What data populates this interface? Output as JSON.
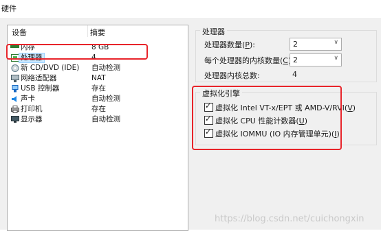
{
  "window": {
    "title": "硬件"
  },
  "devices": {
    "header": {
      "col_device": "设备",
      "col_summary": "摘要"
    },
    "items": [
      {
        "icon": "memory-icon",
        "name": "内存",
        "summary": "8 GB"
      },
      {
        "icon": "processor-icon",
        "name": "处理器",
        "summary": "4"
      },
      {
        "icon": "cd-dvd-icon",
        "name": "新 CD/DVD (IDE)",
        "summary": "自动检测"
      },
      {
        "icon": "network-adapter-icon",
        "name": "网络适配器",
        "summary": "NAT"
      },
      {
        "icon": "usb-icon",
        "name": "USB 控制器",
        "summary": "存在"
      },
      {
        "icon": "sound-card-icon",
        "name": "声卡",
        "summary": "自动检测"
      },
      {
        "icon": "printer-icon",
        "name": "打印机",
        "summary": "存在"
      },
      {
        "icon": "display-icon",
        "name": "显示器",
        "summary": "自动检测"
      }
    ],
    "selected": "处理器"
  },
  "processor_group": {
    "legend": "处理器",
    "num_processors": {
      "label_pre": "处理器数量(",
      "key": "P",
      "label_post": "):",
      "value": "2"
    },
    "cores_per_processor": {
      "label_pre": "每个处理器的内核数量(",
      "key": "C",
      "label_post": "):",
      "value": "2"
    },
    "total_cores": {
      "label": "处理器内核总数:",
      "value": "4"
    }
  },
  "virtualization_group": {
    "legend": "虚拟化引擎",
    "options": [
      {
        "label_pre": "虚拟化 Intel VT-x/EPT 或 AMD-V/RVI(",
        "key": "V",
        "label_post": ")",
        "checked": true
      },
      {
        "label_pre": "虚拟化 CPU 性能计数器(",
        "key": "U",
        "label_post": ")",
        "checked": true
      },
      {
        "label_pre": "虚拟化 IOMMU (IO 内存管理单元)(",
        "key": "I",
        "label_post": ")",
        "checked": true
      }
    ]
  },
  "watermark": "https://blog.csdn.net/cuichongxin",
  "colors": {
    "highlight": "#e8242a",
    "selection": "#cce8ff"
  }
}
